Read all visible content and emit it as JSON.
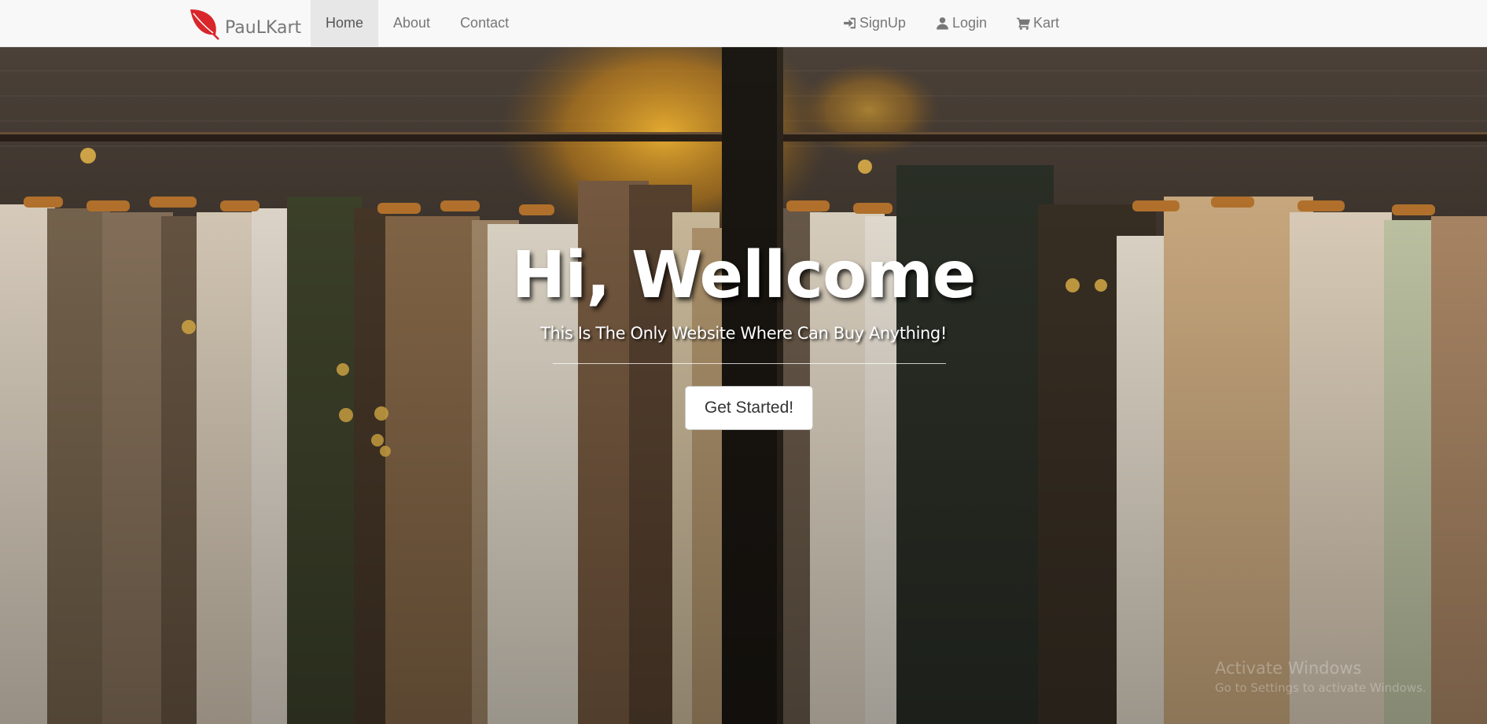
{
  "brand": {
    "name": "PauLKart",
    "logo_icon": "leaf-icon",
    "logo_color": "#d9262b"
  },
  "nav": {
    "left": [
      {
        "label": "Home",
        "active": true
      },
      {
        "label": "About",
        "active": false
      },
      {
        "label": "Contact",
        "active": false
      }
    ],
    "right": [
      {
        "label": "SignUp",
        "icon": "sign-in-icon"
      },
      {
        "label": "Login",
        "icon": "user-icon"
      },
      {
        "label": "Kart",
        "icon": "shopping-cart-icon"
      }
    ]
  },
  "hero": {
    "title": "Hi, Wellcome",
    "subtitle": "This Is The Only Website Where Can Buy Anything!",
    "cta_label": "Get Started!",
    "background": "clothing-rack-photo"
  },
  "watermark": {
    "title": "Activate Windows",
    "subtitle": "Go to Settings to activate Windows."
  },
  "colors": {
    "navbar_bg": "#f8f8f8",
    "nav_text": "#777777",
    "active_bg": "#e7e7e7"
  }
}
